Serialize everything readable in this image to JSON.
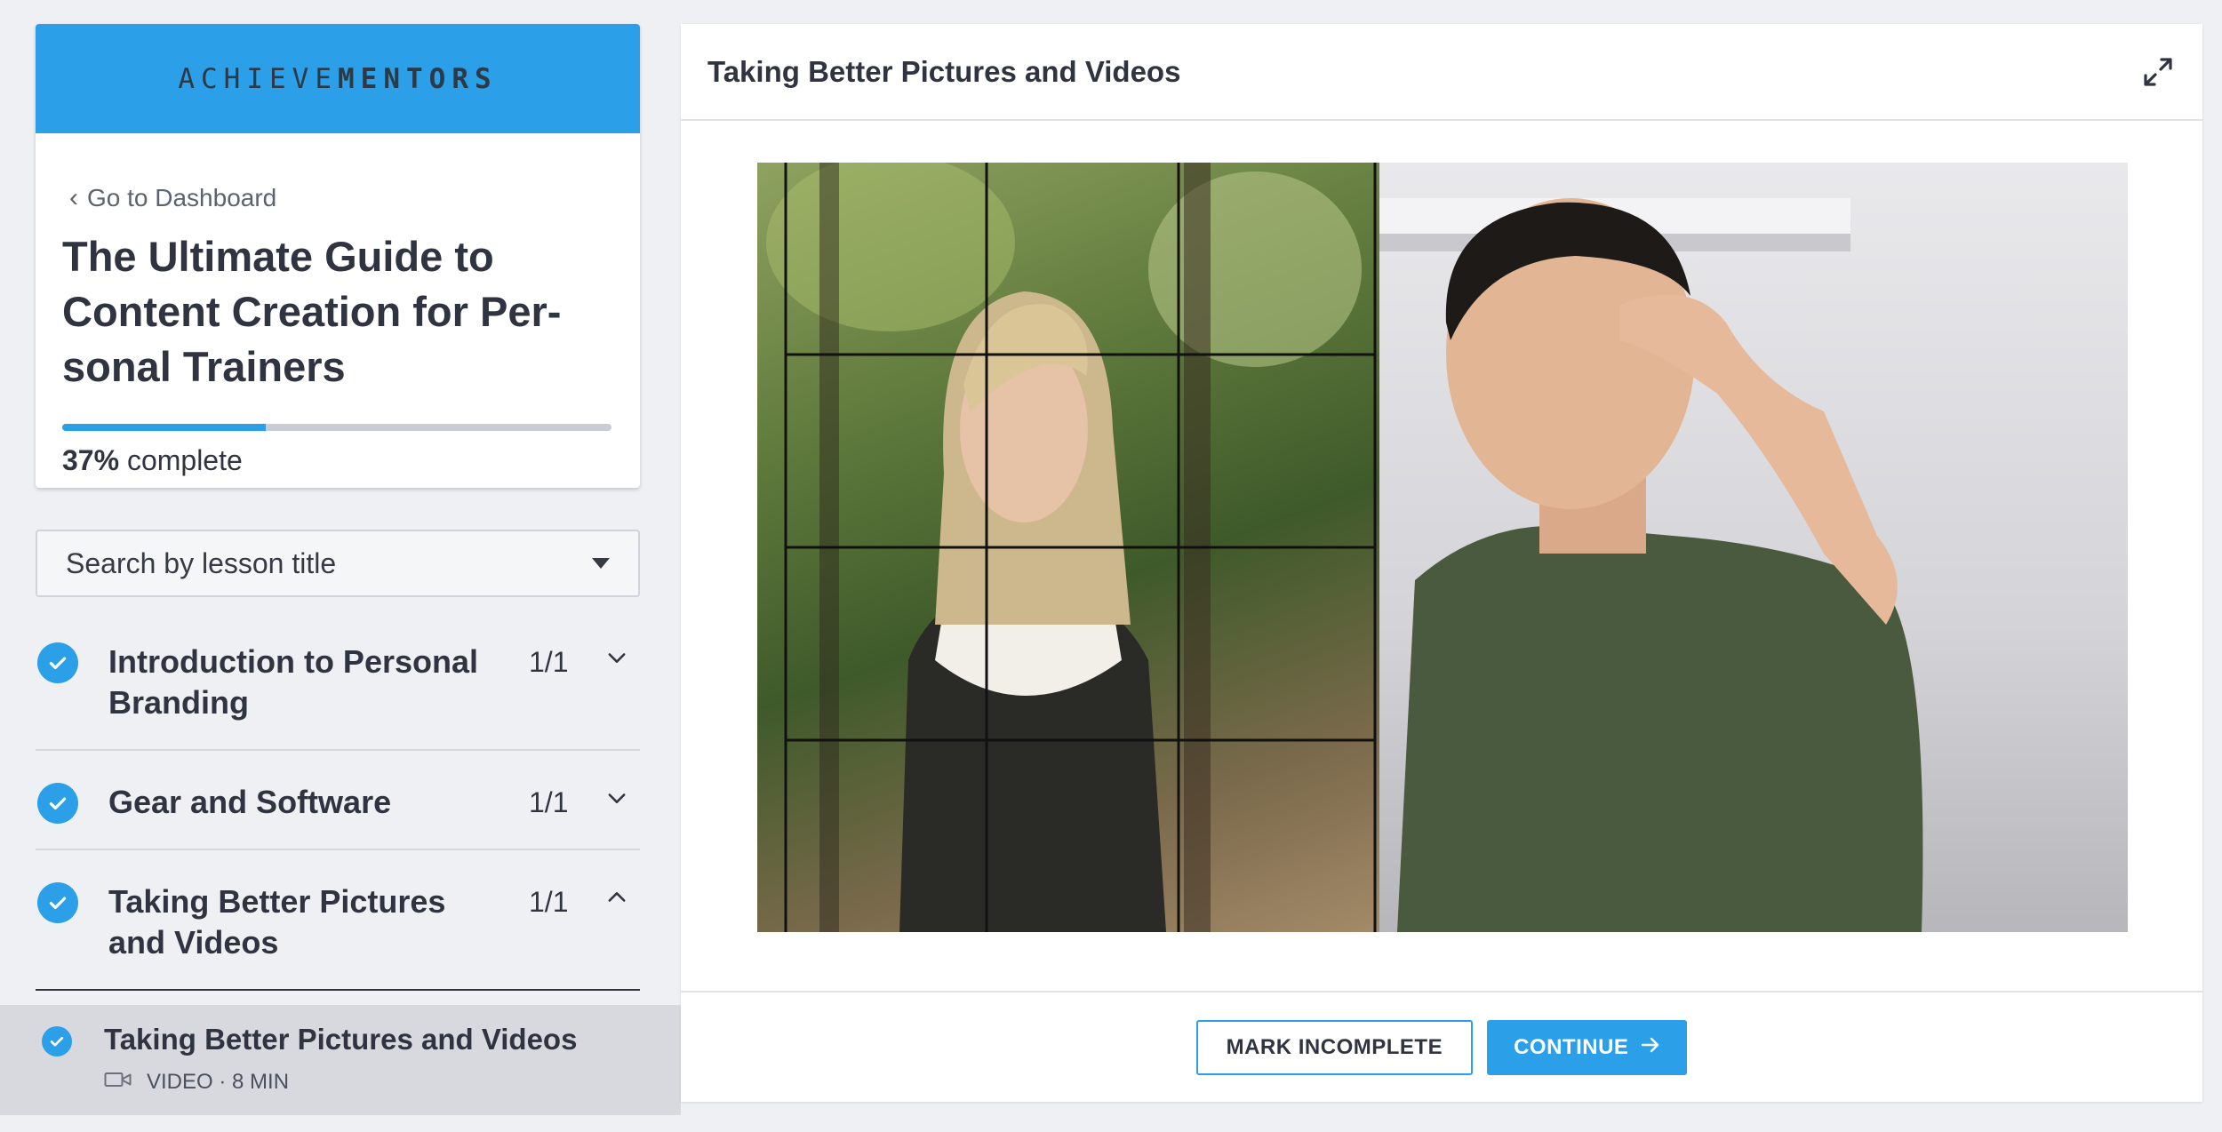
{
  "brand": {
    "logo_part1": "ACHIEVE",
    "logo_part2": "MENTORS",
    "color": "#2b9fe8"
  },
  "course": {
    "back_label": "Go to Dashboard",
    "title": "The Ultimate Guide to Content Creation for Per-sonal Trainers",
    "progress_fraction": 0.37,
    "progress_pct": "37%",
    "progress_suffix": " complete"
  },
  "search": {
    "label": "Search by lesson title"
  },
  "modules": [
    {
      "title": "Introduction to Personal Branding",
      "count": "1/1",
      "expanded": false
    },
    {
      "title": "Gear and Software",
      "count": "1/1",
      "expanded": false
    },
    {
      "title": "Taking Better Pictures and Videos",
      "count": "1/1",
      "expanded": true
    }
  ],
  "active_lesson": {
    "title": "Taking Better Pictures and Videos",
    "meta": "VIDEO · 8 MIN"
  },
  "main": {
    "title": "Taking Better Pictures and Videos",
    "mark_incomplete_label": "MARK INCOMPLETE",
    "continue_label": "CONTINUE"
  }
}
